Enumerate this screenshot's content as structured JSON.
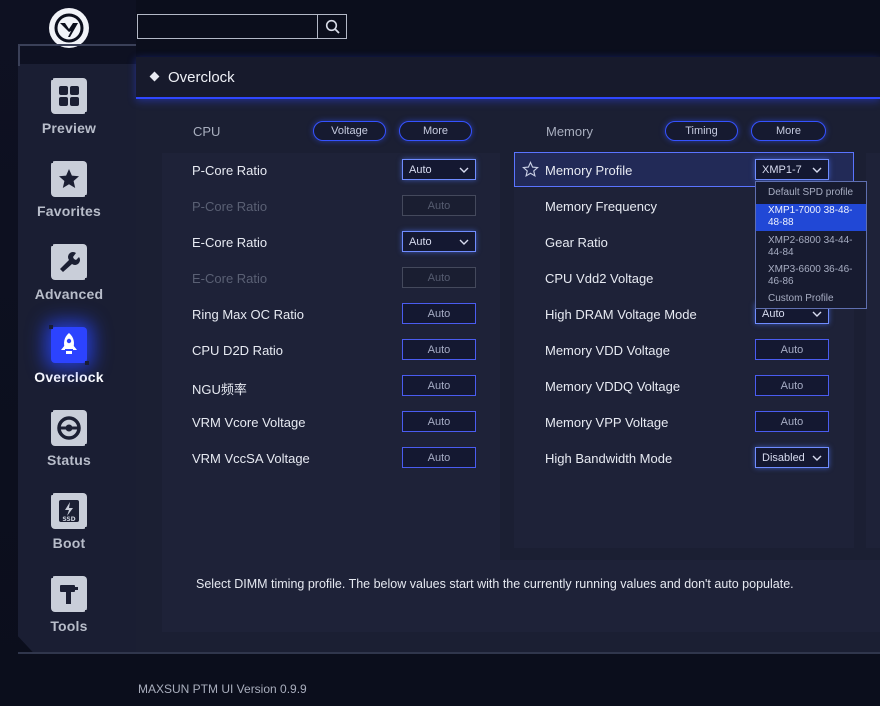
{
  "app": {
    "version": "MAXSUN PTM UI Version 0.9.9"
  },
  "colors": {
    "accent": "#2c43ff",
    "panel": "#1b1f33",
    "background": "#0b0e1c"
  },
  "search": {
    "value": "",
    "icon": "search-icon"
  },
  "sidebar": {
    "items": [
      {
        "label": "Preview",
        "icon": "grid-icon"
      },
      {
        "label": "Favorites",
        "icon": "star-icon"
      },
      {
        "label": "Advanced",
        "icon": "wrench-icon"
      },
      {
        "label": "Overclock",
        "icon": "rocket-icon",
        "active": true
      },
      {
        "label": "Status",
        "icon": "gauge-icon"
      },
      {
        "label": "Boot",
        "icon": "ssd-icon"
      },
      {
        "label": "Tools",
        "icon": "hammer-icon"
      }
    ]
  },
  "page": {
    "title": "Overclock"
  },
  "cpu": {
    "header": "CPU",
    "buttons": {
      "voltage": "Voltage",
      "more": "More"
    },
    "rows": [
      {
        "label": "P-Core Ratio",
        "value": "Auto",
        "type": "dropdown"
      },
      {
        "label": "P-Core Ratio",
        "value": "Auto",
        "type": "disabled"
      },
      {
        "label": "E-Core Ratio",
        "value": "Auto",
        "type": "dropdown"
      },
      {
        "label": "E-Core Ratio",
        "value": "Auto",
        "type": "disabled"
      },
      {
        "label": "Ring Max OC Ratio",
        "value": "Auto",
        "type": "input"
      },
      {
        "label": "CPU D2D Ratio",
        "value": "Auto",
        "type": "input"
      },
      {
        "label": "NGU频率",
        "value": "Auto",
        "type": "input"
      },
      {
        "label": "VRM Vcore Voltage",
        "value": "Auto",
        "type": "input"
      },
      {
        "label": "VRM VccSA Voltage",
        "value": "Auto",
        "type": "input"
      }
    ]
  },
  "memory": {
    "header": "Memory",
    "buttons": {
      "timing": "Timing",
      "more": "More"
    },
    "rows": [
      {
        "label": "Memory Profile",
        "value": "XMP1-7",
        "type": "dropdown"
      },
      {
        "label": "Memory Frequency",
        "value": "",
        "type": "hidden"
      },
      {
        "label": "Gear Ratio",
        "value": "",
        "type": "hidden"
      },
      {
        "label": "CPU Vdd2 Voltage",
        "value": "",
        "type": "hidden"
      },
      {
        "label": "High DRAM Voltage Mode",
        "value": "Auto",
        "type": "dropdown"
      },
      {
        "label": "Memory VDD Voltage",
        "value": "Auto",
        "type": "input"
      },
      {
        "label": "Memory VDDQ Voltage",
        "value": "Auto",
        "type": "input"
      },
      {
        "label": "Memory VPP Voltage",
        "value": "Auto",
        "type": "input"
      },
      {
        "label": "High Bandwidth Mode",
        "value": "Disabled",
        "type": "dropdown"
      }
    ],
    "profile_options": [
      {
        "line1": "Default SPD profile",
        "line2": ""
      },
      {
        "line1": "XMP1-7000 38-48-",
        "line2": "48-88",
        "selected": true
      },
      {
        "line1": "XMP2-6800 34-44-",
        "line2": "44-84"
      },
      {
        "line1": "XMP3-6600 36-46-",
        "line2": "46-86"
      },
      {
        "line1": "Custom Profile",
        "line2": ""
      }
    ]
  },
  "help": {
    "text": "Select DIMM timing profile. The below values start with the currently running values and don't auto populate."
  }
}
